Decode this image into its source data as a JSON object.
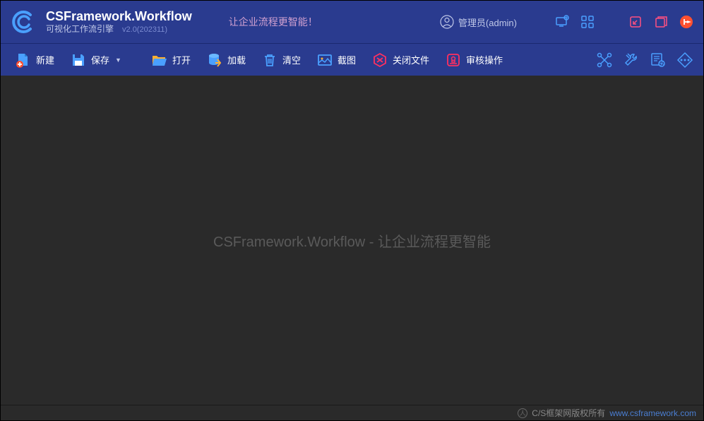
{
  "header": {
    "title": "CSFramework.Workflow",
    "subtitle": "可视化工作流引擎",
    "version": "v2.0(202311)",
    "tagline": "让企业流程更智能！",
    "user_label": "管理员(admin)"
  },
  "toolbar": {
    "new_label": "新建",
    "save_label": "保存",
    "open_label": "打开",
    "load_label": "加载",
    "clear_label": "清空",
    "screenshot_label": "截图",
    "close_file_label": "关闭文件",
    "audit_label": "审核操作"
  },
  "canvas": {
    "watermark": "CSFramework.Workflow  - 让企业流程更智能"
  },
  "footer": {
    "copyright": "C/S框架网版权所有",
    "url": "www.csframework.com"
  }
}
